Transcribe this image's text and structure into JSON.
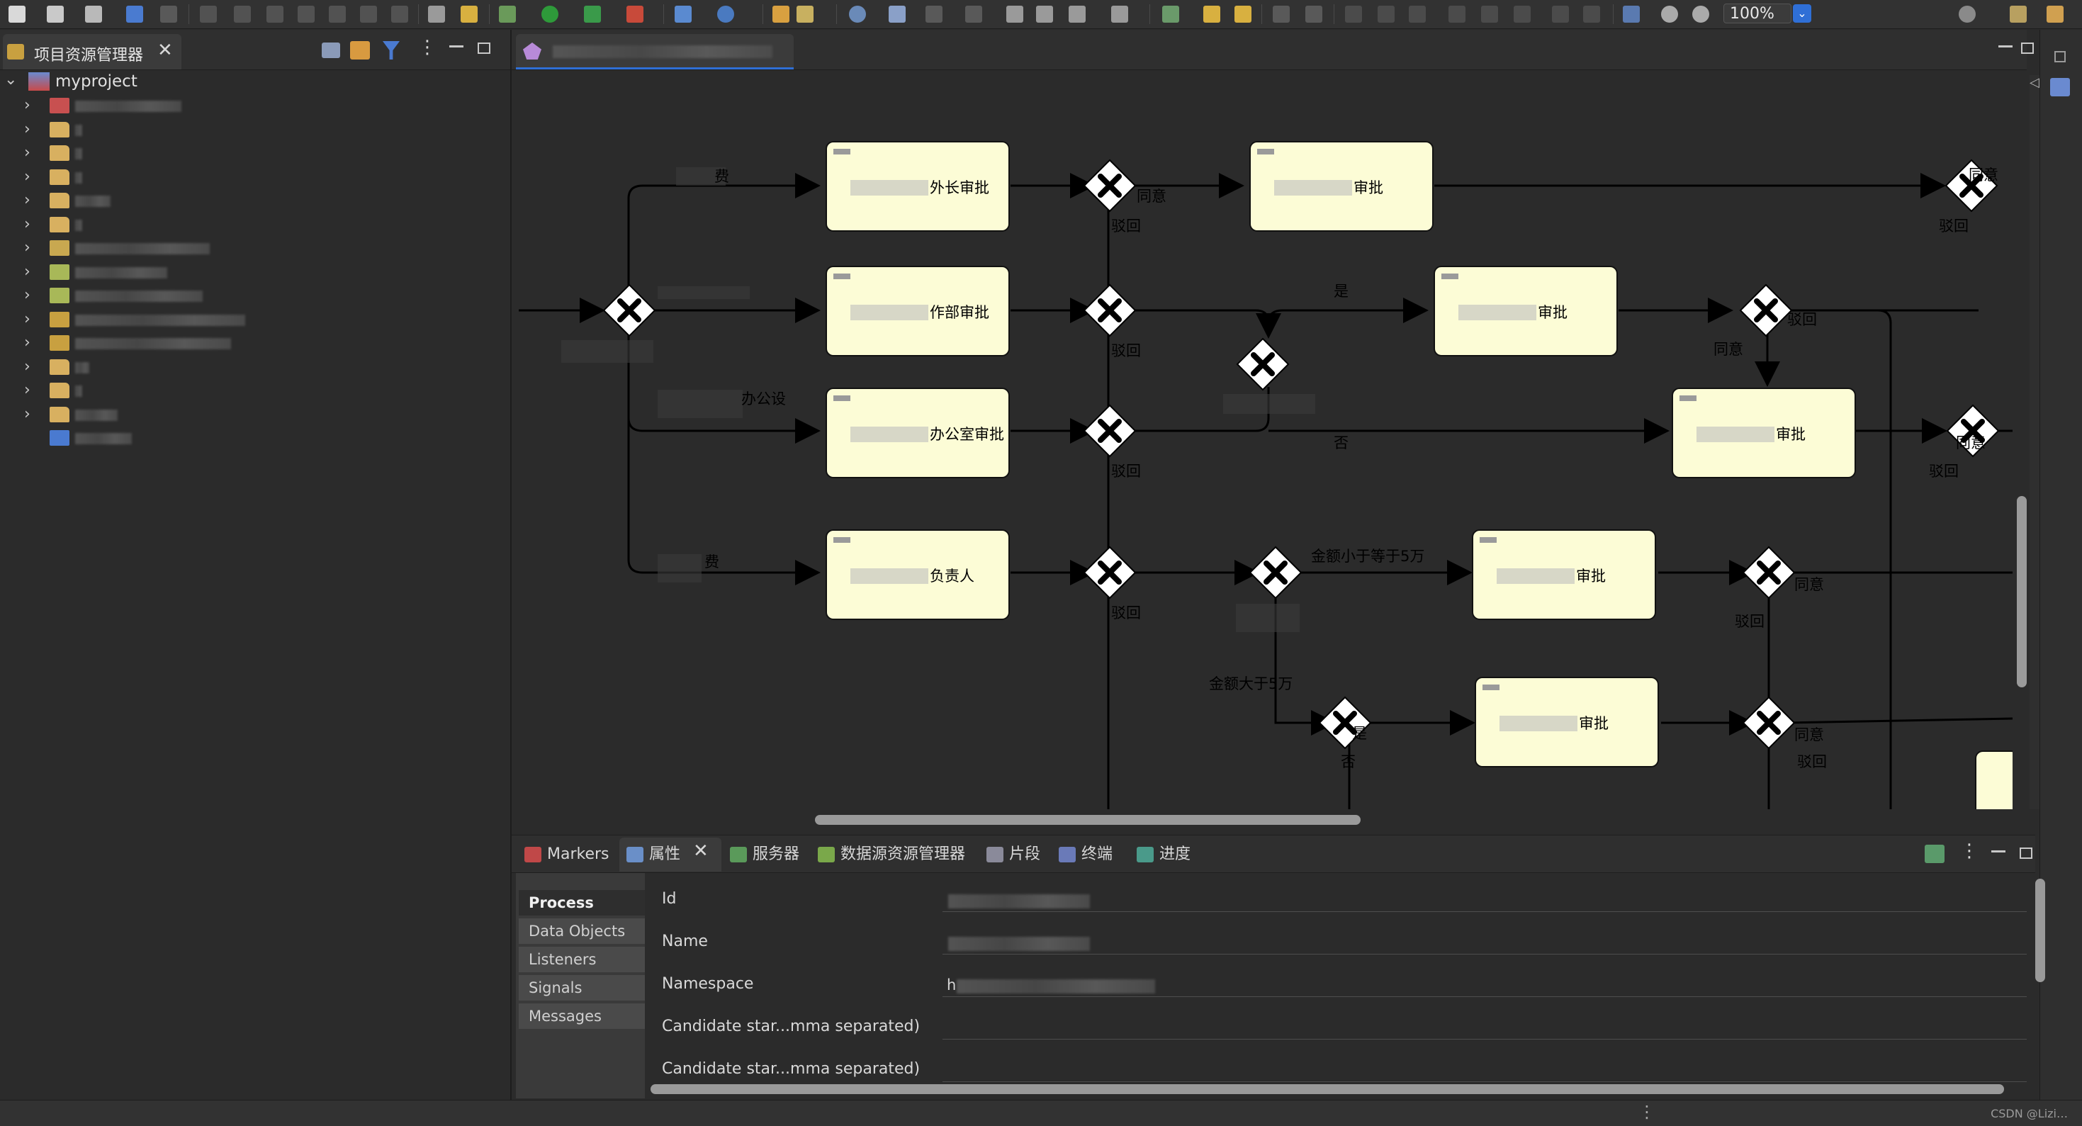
{
  "toolbar": {
    "zoom_value": "100%",
    "zoom_dropdown_glyph": "⌄"
  },
  "project_explorer": {
    "tab_label": "项目资源管理器",
    "project_name": "myproject",
    "items": [
      {
        "icon": "java-project-icon",
        "label": ""
      },
      {
        "icon": "folder-icon",
        "label": ""
      },
      {
        "icon": "folder-icon",
        "label": ""
      },
      {
        "icon": "folder-icon",
        "label": ""
      },
      {
        "icon": "folder-icon",
        "label": ""
      },
      {
        "icon": "folder-icon",
        "label": ""
      },
      {
        "icon": "package-folder-icon",
        "label": ""
      },
      {
        "icon": "source-folder-icon",
        "label": ""
      },
      {
        "icon": "source-folder-icon",
        "label": ""
      },
      {
        "icon": "library-icon",
        "label": ""
      },
      {
        "icon": "library-icon",
        "label": ""
      },
      {
        "icon": "folder-icon",
        "label": ""
      },
      {
        "icon": "folder-icon",
        "label": ""
      },
      {
        "icon": "folder-icon",
        "label": ""
      },
      {
        "icon": "maven-file-icon",
        "label": ""
      }
    ]
  },
  "editor": {
    "tab_label": ""
  },
  "diagram": {
    "tasks": [
      "外长审批",
      "审批",
      "作部审批",
      "审批",
      "办公室审批",
      "审批",
      "负责人",
      "审批",
      "审批"
    ],
    "edge_labels": {
      "l1": "费",
      "l2": "办公设",
      "l3": "费",
      "agree": "同意",
      "reject": "驳回",
      "yes": "是",
      "no": "否",
      "amount_lt": "金额小于等于5万",
      "amount_gt": "金额大于5万"
    }
  },
  "bottom_tabs": [
    {
      "icon": "markers-icon",
      "label": "Markers",
      "color": "#c04848"
    },
    {
      "icon": "properties-icon",
      "label": "属性",
      "color": "#6a8fc8"
    },
    {
      "icon": "servers-icon",
      "label": "服务器",
      "color": "#5a9a5a"
    },
    {
      "icon": "data-source-explorer-icon",
      "label": "数据源资源管理器",
      "color": "#7aa84a"
    },
    {
      "icon": "snippets-icon",
      "label": "片段",
      "color": "#8a8a9a"
    },
    {
      "icon": "terminal-icon",
      "label": "终端",
      "color": "#6a7ab8"
    },
    {
      "icon": "progress-icon",
      "label": "进度",
      "color": "#4a9a8a"
    }
  ],
  "properties": {
    "sections": [
      "Process",
      "Data Objects",
      "Listeners",
      "Signals",
      "Messages"
    ],
    "fields": [
      {
        "label": "Id",
        "value": ""
      },
      {
        "label": "Name",
        "value": ""
      },
      {
        "label": "Namespace",
        "value": "h"
      },
      {
        "label": "Candidate star...mma separated)",
        "value": ""
      },
      {
        "label": "Candidate star...mma separated)",
        "value": ""
      }
    ]
  },
  "status": {
    "watermark": "CSDN @Lizi…"
  },
  "colors": {
    "accent": "#2f6fd6",
    "task_fill": "#fcfcd6",
    "background": "#2b2b2b"
  }
}
